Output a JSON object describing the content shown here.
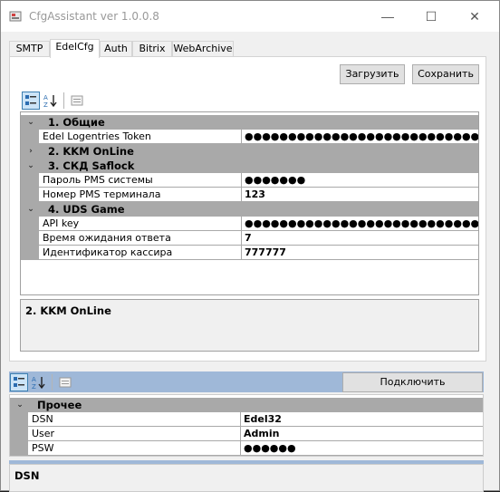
{
  "window": {
    "title": "CfgAssistant ver 1.0.0.8",
    "minimize_symbol": "—",
    "maximize_symbol": "☐",
    "close_symbol": "✕"
  },
  "tabs": [
    "SMTP",
    "EdelCfg",
    "Auth",
    "Bitrix",
    "WebArchive"
  ],
  "active_tab": "EdelCfg",
  "tabpage": {
    "load_button": "Загрузить",
    "save_button": "Сохранить",
    "grid": {
      "categories": [
        {
          "expander": "⌄",
          "label": "1. Общие",
          "expanded": true,
          "properties": [
            {
              "name": "Edel Logentries Token",
              "value": "●●●●●●●●●●●●●●●●●●●●●●●●●●●●●●●●●●●●●"
            }
          ]
        },
        {
          "expander": "›",
          "label": "2. KKM OnLine",
          "expanded": false,
          "properties": []
        },
        {
          "expander": "⌄",
          "label": "3. СКД Saflock",
          "expanded": true,
          "properties": [
            {
              "name": "Пароль PMS системы",
              "value": "●●●●●●●"
            },
            {
              "name": "Номер PMS терминала",
              "value": "123"
            }
          ]
        },
        {
          "expander": "⌄",
          "label": "4. UDS Game",
          "expanded": true,
          "properties": [
            {
              "name": "API key",
              "value": "●●●●●●●●●●●●●●●●●●●●●●●●●●●●●●●●●●●●●"
            },
            {
              "name": "Время ожидания ответа",
              "value": "7"
            },
            {
              "name": "Идентификатор кассира",
              "value": "777777"
            }
          ]
        }
      ]
    },
    "help_title": "2. KKM OnLine"
  },
  "bottom": {
    "connect_button": "Подключить",
    "grid": {
      "categories": [
        {
          "expander": "⌄",
          "label": "Прочее",
          "expanded": true,
          "properties": [
            {
              "name": "DSN",
              "value": "Edel32"
            },
            {
              "name": "User",
              "value": "Admin"
            },
            {
              "name": "PSW",
              "value": "●●●●●●"
            }
          ]
        }
      ]
    },
    "help_title": "DSN"
  },
  "colors": {
    "category_bg": "#a9a9a9",
    "selected_toolbar": "#cce4f7",
    "bottom_toolbar_bg": "#9fb8d8"
  }
}
